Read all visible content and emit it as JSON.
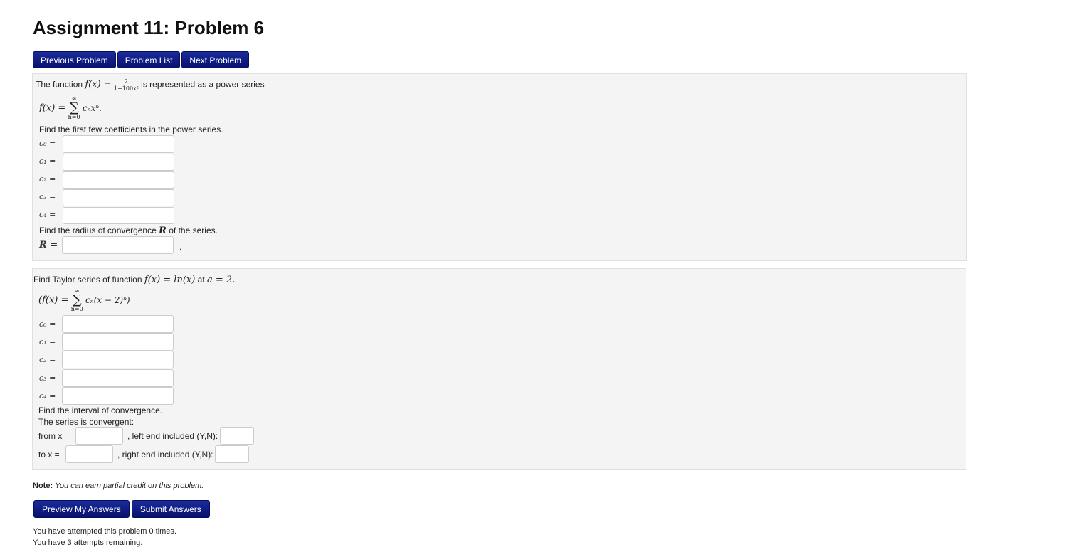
{
  "page_title": "Assignment 11: Problem 6",
  "nav": {
    "previous": "Previous Problem",
    "list": "Problem List",
    "next": "Next Problem"
  },
  "part1": {
    "intro_prefix": "The function ",
    "fx": "f(x) =",
    "frac_num": "2",
    "frac_den": "1+100x²",
    "intro_suffix": " is represented as a power series",
    "series_lhs": "f(x) =",
    "sum_top": "∞",
    "sum_sigma": "∑",
    "sum_bottom": "n=0",
    "series_rhs": "cₙxⁿ.",
    "find_coeffs": "Find the first few coefficients in the power series.",
    "coeff_labels": [
      "c₀ =",
      "c₁ =",
      "c₂ =",
      "c₃ =",
      "c₄ ="
    ],
    "coeff_values": [
      "",
      "",
      "",
      "",
      ""
    ],
    "radius_prompt_prefix": "Find the radius of convergence ",
    "radius_symbol": "R",
    "radius_prompt_suffix": " of the series.",
    "radius_label": "R =",
    "radius_value": "",
    "radius_period": "."
  },
  "part2": {
    "intro_prefix": "Find Taylor series of function ",
    "fx": "f(x) = ln(x)",
    "at": " at ",
    "a_eq": "a = 2.",
    "series_lhs": "(f(x) =",
    "sum_top": "∞",
    "sum_sigma": "∑",
    "sum_bottom": "n=0",
    "series_rhs": "cₙ(x − 2)ⁿ)",
    "coeff_labels": [
      "c₀ =",
      "c₁ =",
      "c₂ =",
      "c₃ =",
      "c₄ ="
    ],
    "coeff_values": [
      "",
      "",
      "",
      "",
      ""
    ],
    "interval_prompt": "Find the interval of convergence.",
    "convergent_text": "The series is convergent:",
    "from_label": "from x =",
    "left_end_label": ", left end included (Y,N):",
    "to_label": "to x =",
    "right_end_label": ", right end included (Y,N):",
    "from_value": "",
    "left_value": "",
    "to_value": "",
    "right_value": ""
  },
  "note": {
    "label": "Note:",
    "text": "You can earn partial credit on this problem."
  },
  "actions": {
    "preview": "Preview My Answers",
    "submit": "Submit Answers"
  },
  "status": {
    "attempted": "You have attempted this problem 0 times.",
    "remaining": "You have 3 attempts remaining."
  }
}
